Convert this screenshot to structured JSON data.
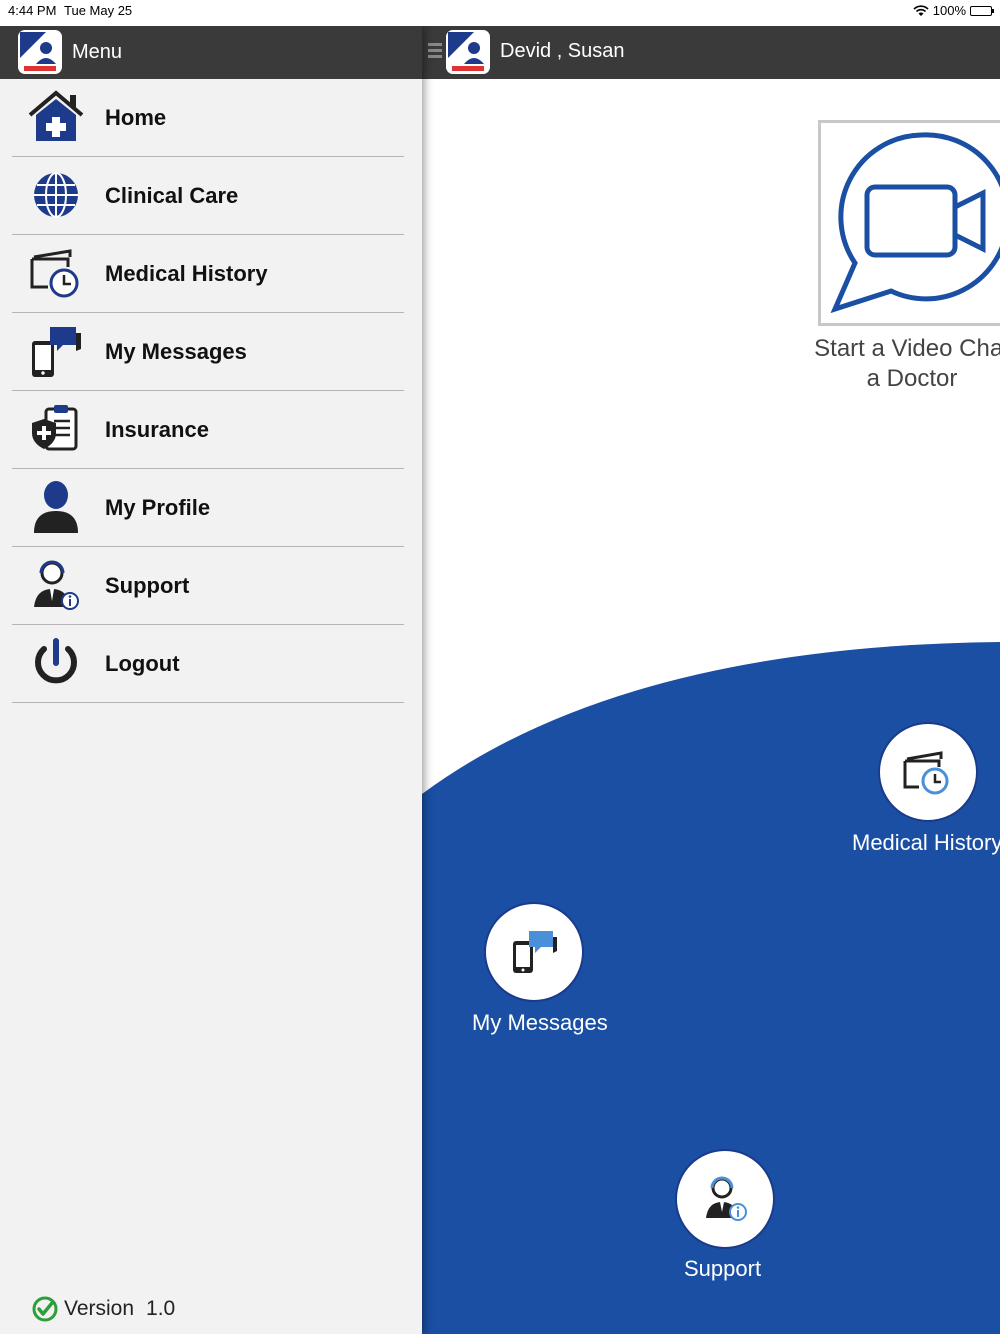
{
  "status_bar": {
    "time": "4:44 PM",
    "date": "Tue May 25",
    "battery": "100%"
  },
  "drawer": {
    "title": "Menu",
    "items": [
      {
        "label": "Home",
        "icon": "home-icon"
      },
      {
        "label": "Clinical Care",
        "icon": "globe-icon"
      },
      {
        "label": "Medical History",
        "icon": "medical-history-icon"
      },
      {
        "label": "My Messages",
        "icon": "messages-icon"
      },
      {
        "label": "Insurance",
        "icon": "insurance-icon"
      },
      {
        "label": "My Profile",
        "icon": "profile-icon"
      },
      {
        "label": "Support",
        "icon": "support-icon"
      },
      {
        "label": "Logout",
        "icon": "power-icon"
      }
    ],
    "version_label": "Version",
    "version_number": "1.0"
  },
  "main": {
    "user_name": "Devid ,  Susan",
    "video_chat_line1": "Start a Video Chat",
    "video_chat_line2": "a Doctor",
    "medical_history_label": "Medical History",
    "my_messages_label": "My Messages",
    "support_label": "Support"
  },
  "colors": {
    "header": "#3a3a3a",
    "brand_blue": "#1a4fa3",
    "icon_navy": "#1e3a8a",
    "check_green": "#2e9e3a"
  }
}
